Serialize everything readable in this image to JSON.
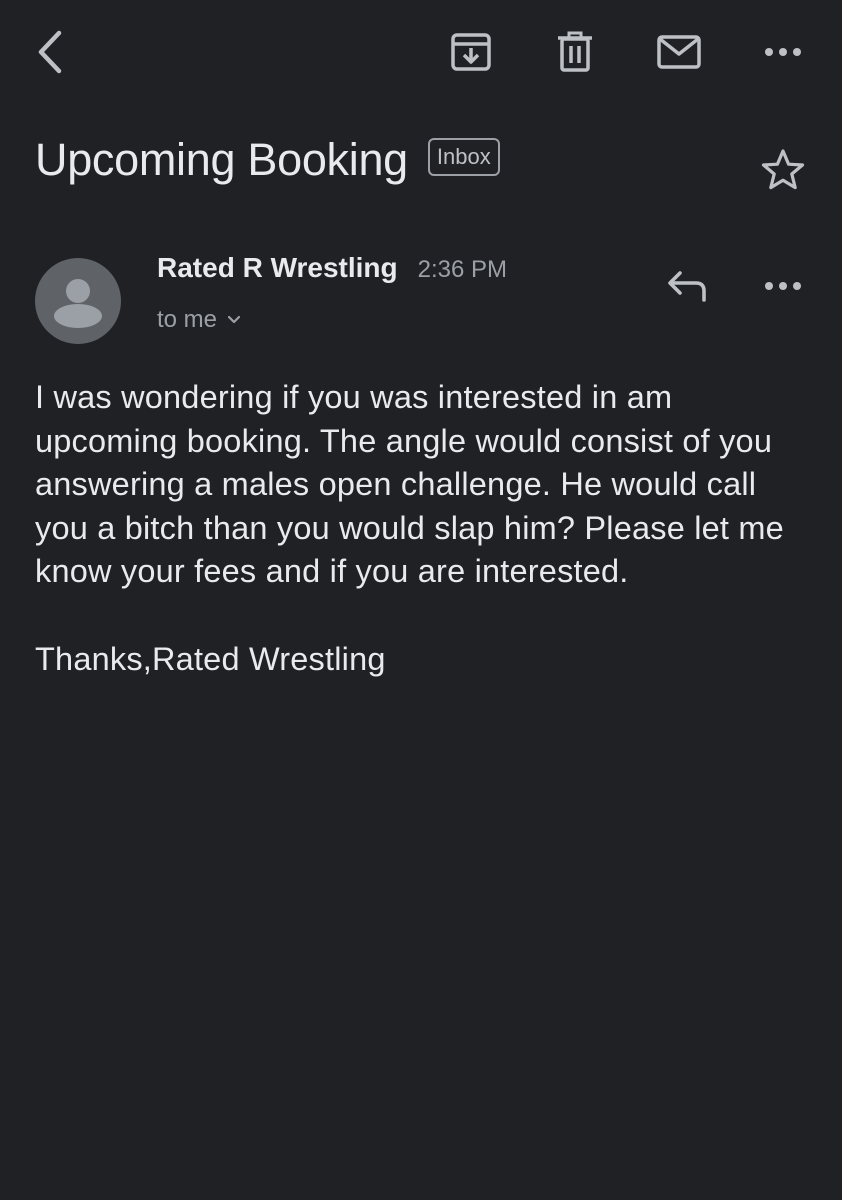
{
  "toolbar": {
    "back_icon": "chevron-left-icon",
    "archive_icon": "archive-icon",
    "delete_icon": "trash-icon",
    "mark_unread_icon": "mail-icon",
    "more_icon": "more-horiz-icon"
  },
  "email": {
    "subject": "Upcoming Booking",
    "label": "Inbox",
    "star_icon": "star-outline-icon",
    "sender": {
      "name": "Rated R Wrestling",
      "time": "2:36 PM",
      "recipient": "to me",
      "avatar_icon": "person-avatar-icon"
    },
    "actions": {
      "reply_icon": "reply-icon",
      "more_icon": "more-horiz-icon"
    },
    "body": {
      "paragraph": "I was wondering if you was interested in am upcoming booking. The angle would consist of you answering a males open challenge. He would call you a bitch than you would slap him? Please let me know your fees and if you are interested.",
      "signoff": "Thanks,Rated Wrestling"
    }
  },
  "colors": {
    "background": "#202124",
    "text_primary": "#e8eaed",
    "text_secondary": "#9aa0a6",
    "icon": "#bdc1c6",
    "avatar_bg": "#5f6368",
    "avatar_fg": "#9aa0a6"
  }
}
